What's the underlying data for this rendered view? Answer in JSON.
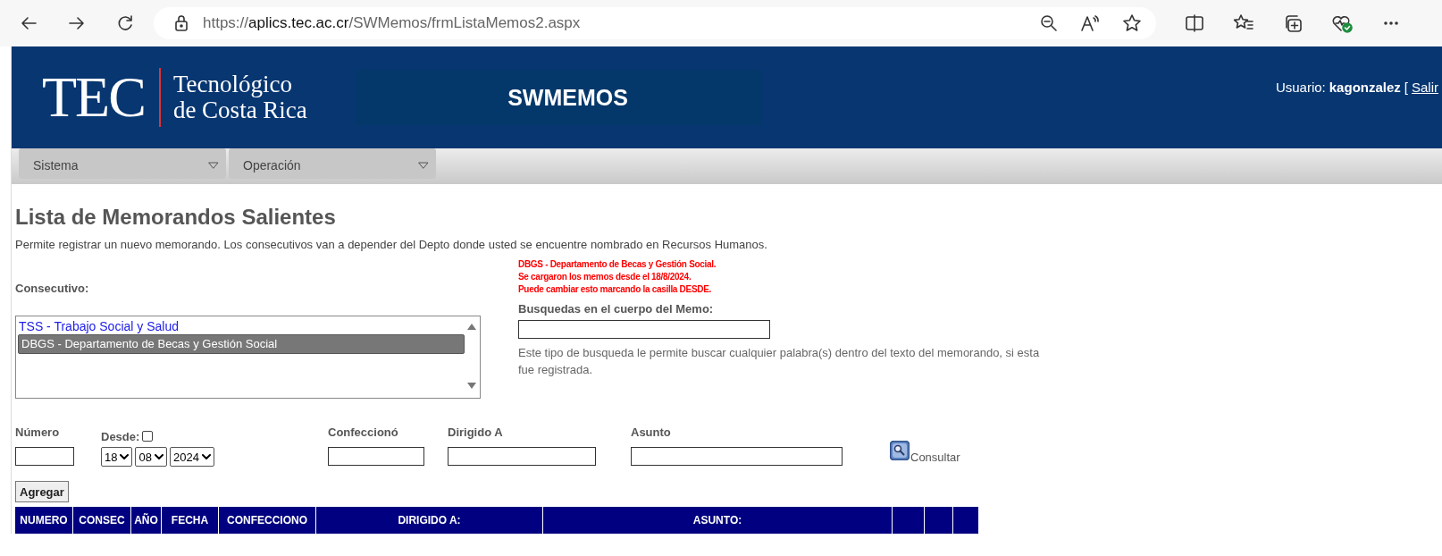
{
  "browser": {
    "url_scheme": "https://",
    "url_host": "aplics.tec.ac.cr",
    "url_path": "/SWMemos/frmListaMemos2.aspx"
  },
  "header": {
    "logo_mark": "TEC",
    "logo_line_1": "Tecnológico",
    "logo_line_2": "de Costa Rica",
    "app_title": "SWMEMOS",
    "user_label": "Usuario:",
    "user_name": "kagonzalez",
    "logout_bracket": "[",
    "logout_link": "Salir"
  },
  "menu": [
    {
      "label": "Sistema"
    },
    {
      "label": "Operación"
    }
  ],
  "page": {
    "title": "Lista de Memorandos Salientes",
    "description": "Permite registrar un nuevo memorando. Los consecutivos van a depender del Depto donde usted se encuentre nombrado en Recursos Humanos."
  },
  "consecutivo": {
    "label": "Consecutivo:",
    "options": [
      {
        "label": "TSS - Trabajo Social y Salud",
        "selected": false
      },
      {
        "label": "DBGS - Departamento de Becas y Gestión Social",
        "selected": true
      }
    ]
  },
  "notice": [
    "DBGS - Departamento de Becas y Gestión Social.",
    "Se cargaron los memos desde el 18/8/2024.",
    "Puede cambiar esto marcando la casilla DESDE."
  ],
  "body_search": {
    "label": "Busquedas en el cuerpo del Memo:",
    "hint": "Este tipo de busqueda le permite buscar cualquier palabra(s) dentro del texto del memorando, si esta fue registrada."
  },
  "filters": {
    "numero_label": "Número",
    "desde_label": "Desde:",
    "desde_checked": false,
    "day": "18",
    "month": "08",
    "year": "2024",
    "confecciono_label": "Confeccionó",
    "dirigido_label": "Dirigido A",
    "asunto_label": "Asunto",
    "consult_button": "Consultar"
  },
  "add_button": "Agregar",
  "table": {
    "columns": [
      "NUMERO",
      "CONSEC",
      "AÑO",
      "FECHA",
      "CONFECCIONO",
      "DIRIGIDO A:",
      "ASUNTO:",
      "",
      "",
      ""
    ]
  }
}
